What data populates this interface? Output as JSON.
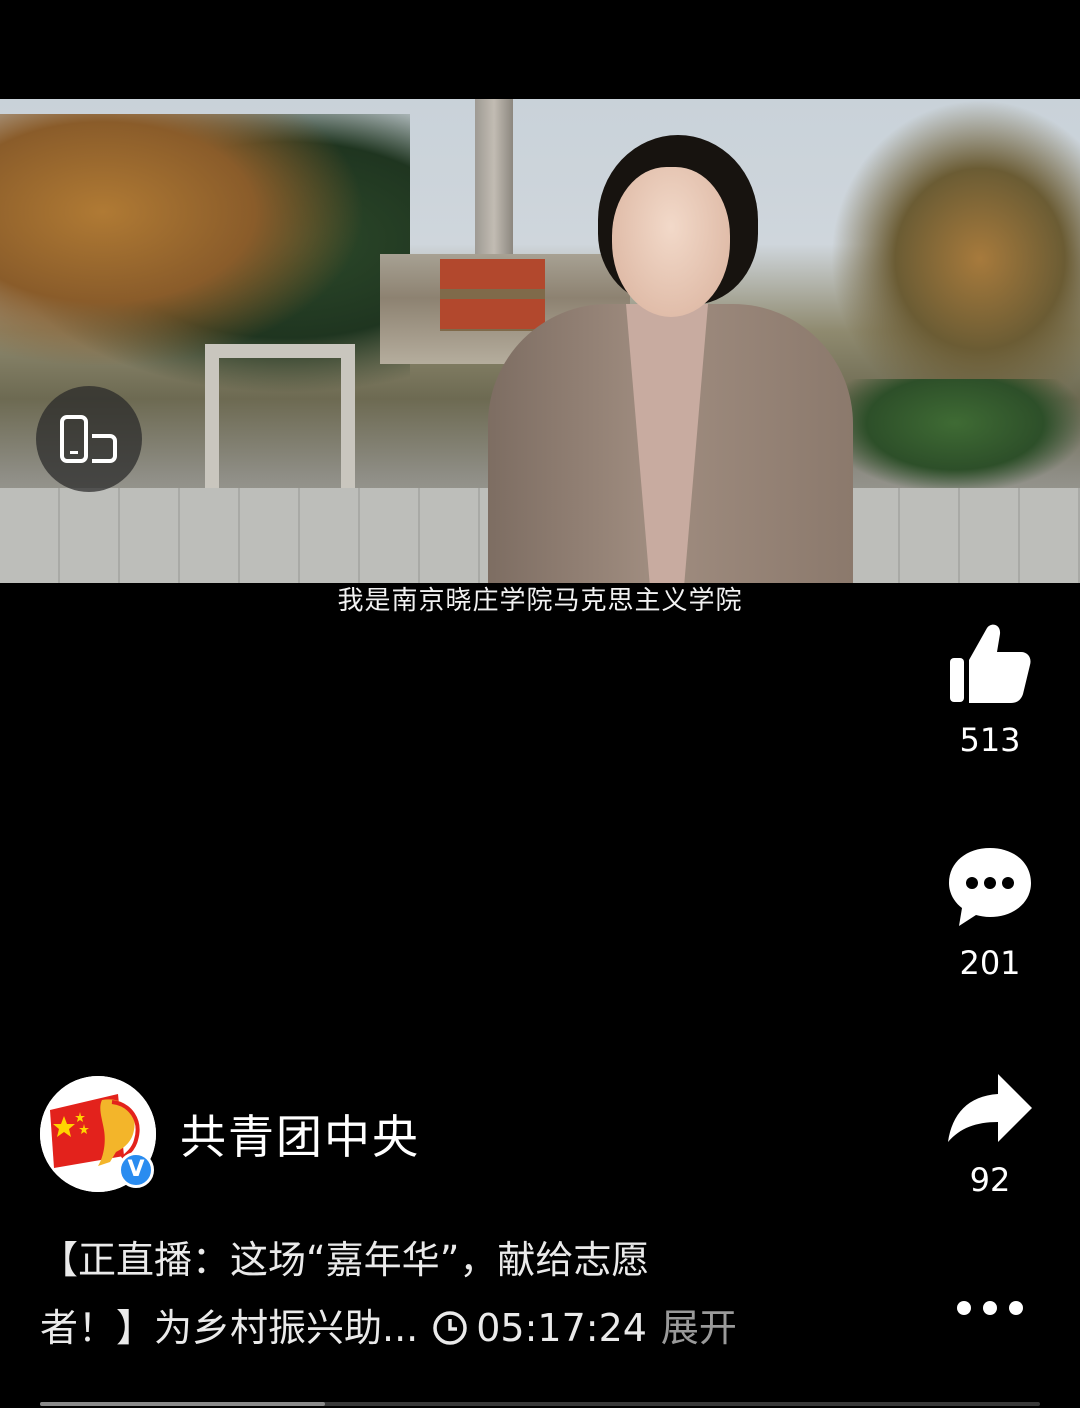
{
  "video": {
    "subtitle": "我是南京晓庄学院马克思主义学院"
  },
  "actions": {
    "like_count": "513",
    "comment_count": "201",
    "share_count": "92"
  },
  "author": {
    "name": "共青团中央",
    "verified": true,
    "verified_mark": "V"
  },
  "caption": {
    "line1": "【正直播：这场“嘉年华”，献给志愿",
    "line2": "者！】为乡村振兴助...",
    "duration": "05:17:24",
    "expand_label": "展开"
  },
  "playback": {
    "progress_fraction": 0.285
  },
  "icons": {
    "orientation": "rotate-screen-icon",
    "like": "thumbs-up-icon",
    "comment": "comment-bubble-icon",
    "share": "share-arrow-icon",
    "more": "more-dots-icon",
    "clock": "clock-icon"
  },
  "colors": {
    "background": "#000000",
    "text": "#ffffff",
    "expand": "#9a9a9a",
    "verified": "#2a8cf0"
  }
}
